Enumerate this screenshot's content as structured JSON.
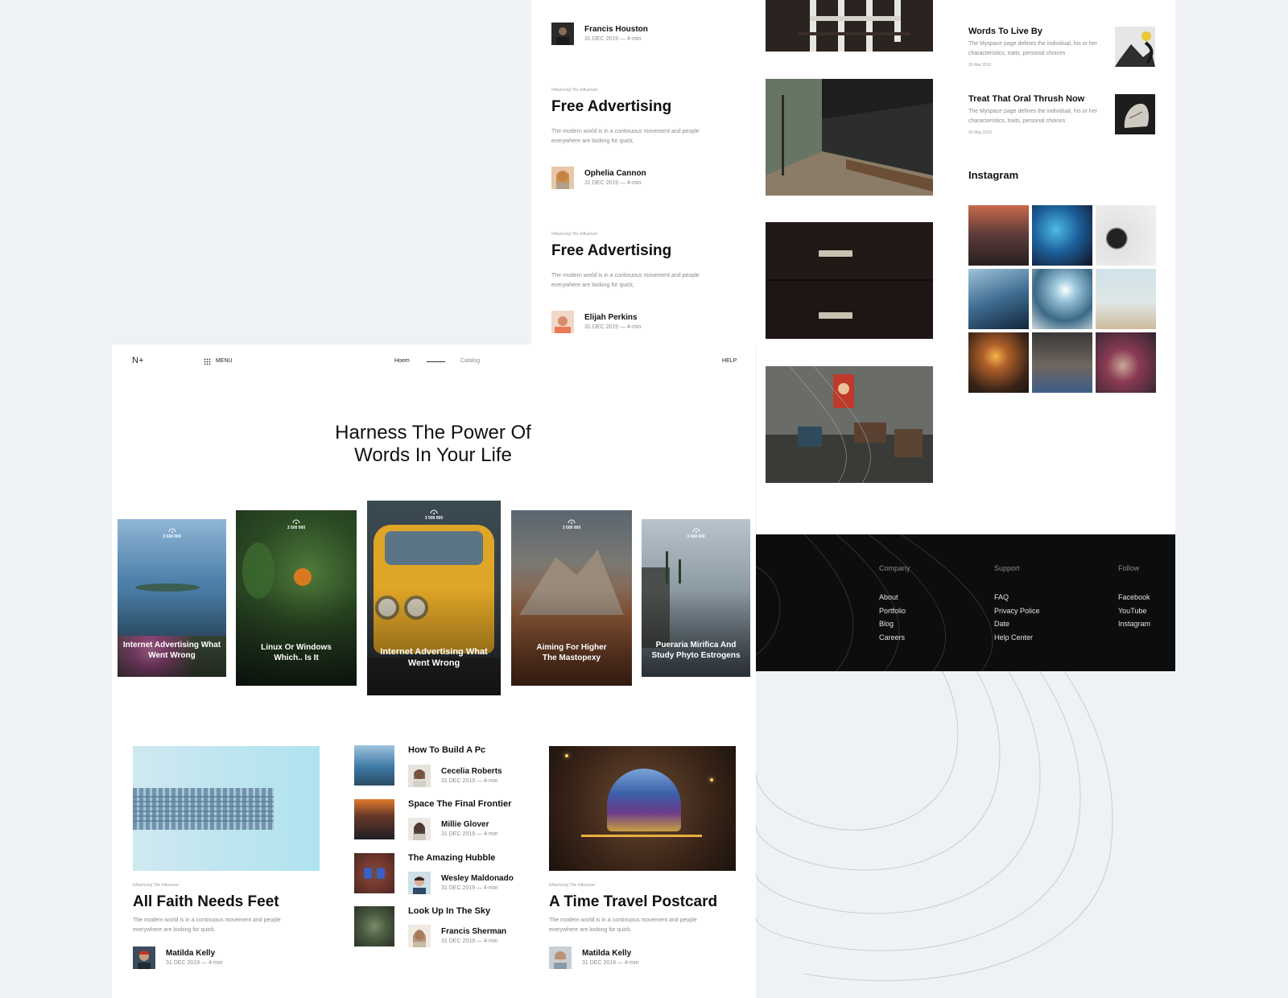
{
  "top_column": {
    "articles": [
      {
        "author": "Francis Houston",
        "meta": "31 DEC 2019 — 4-min"
      },
      {
        "kicker": "Influencing The Influencer",
        "title": "Free Advertising",
        "excerpt": "The modern world is in a continuous movement and people everywhere are looking for quick,",
        "author": "Ophelia Cannon",
        "meta": "31 DEC 2019 — 4-min"
      },
      {
        "kicker": "Influencing The Influencer",
        "title": "Free Advertising",
        "excerpt": "The modern world is in a continuous movement and people everywhere are looking for quick,",
        "author": "Elijah Perkins",
        "meta": "31 DEC 2019 — 4-min"
      }
    ]
  },
  "sidebar": {
    "items": [
      {
        "title": "Words To Live By",
        "text": "The Myspace page defines the individual, his or her characteristics, traits, personal choices",
        "date": "26 Mar 2019"
      },
      {
        "title": "Treat That Oral Thrush Now",
        "text": "The Myspace page defines the individual, his or her characteristics, traits, personal choices",
        "date": "02 May 2019"
      }
    ],
    "instagram_title": "Instagram"
  },
  "footer": {
    "columns": [
      {
        "heading": "Company",
        "links": [
          "About",
          "Portfolio",
          "Blog",
          "Careers"
        ]
      },
      {
        "heading": "Support",
        "links": [
          "FAQ",
          "Privacy Police",
          "Date",
          "Help Center"
        ]
      },
      {
        "heading": "Follow",
        "links": [
          "Facebook",
          "YouTube",
          "Instagram"
        ]
      }
    ]
  },
  "nav": {
    "logo": "N+",
    "menu": "MENU",
    "home": "Hoem",
    "catalog": "Catalog",
    "help": "HELP"
  },
  "hero": {
    "line1": "Harness The Power Of",
    "line2": "Words In Your Life"
  },
  "cards": [
    {
      "count": "3 500 000",
      "title": "Internet Advertising What Went Wrong"
    },
    {
      "count": "3 500 000",
      "title": "Linux Or Windows Which.. Is It"
    },
    {
      "count": "3 500 000",
      "title": "Internet Advertising What Went Wrong"
    },
    {
      "count": "3 500 000",
      "title": "Aiming For Higher The Mastopexy"
    },
    {
      "count": "3 500 000",
      "title": "Pueraria Mirifica And Study Phyto Estrogens"
    }
  ],
  "feature_left": {
    "kicker": "Influencing The Influencer",
    "title": "All Faith Needs Feet",
    "excerpt": "The modern world is in a continuous movement and people everywhere are looking for quick,",
    "author": "Matilda Kelly",
    "meta": "31 DEC 2019 — 4-min"
  },
  "list": [
    {
      "title": "How To Build A Pc",
      "author": "Cecelia Roberts",
      "meta": "31 DEC 2019 — 4-min"
    },
    {
      "title": "Space The Final Frontier",
      "author": "Millie Glover",
      "meta": "31 DEC 2019 — 4-min"
    },
    {
      "title": "The Amazing Hubble",
      "author": "Wesley Maldonado",
      "meta": "31 DEC 2019 — 4-min"
    },
    {
      "title": "Look Up In The Sky",
      "author": "Francis Sherman",
      "meta": "31 DEC 2019 — 4-min"
    }
  ],
  "feature_right": {
    "kicker": "Influencing The Influencer",
    "title": "A Time Travel Postcard",
    "excerpt": "The modern world is in a continuous movement and people everywhere are looking for quick,",
    "author": "Matilda Kelly",
    "meta": "31 DEC 2019 — 4-min"
  },
  "colors": {
    "background": "#eff2f5",
    "footer": "#0d0d0d",
    "text": "#111111",
    "muted": "#8a8a8a"
  }
}
